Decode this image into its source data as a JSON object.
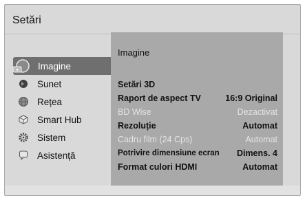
{
  "window": {
    "title": "Setări"
  },
  "menu": {
    "items": [
      {
        "label": "Imagine",
        "icon": "picture-icon",
        "selected": true
      },
      {
        "label": "Sunet",
        "icon": "speaker-icon",
        "selected": false
      },
      {
        "label": "Rețea",
        "icon": "network-globe-icon",
        "selected": false
      },
      {
        "label": "Smart Hub",
        "icon": "smart-hub-cube-icon",
        "selected": false
      },
      {
        "label": "Sistem",
        "icon": "gear-icon",
        "selected": false
      },
      {
        "label": "Asistență",
        "icon": "support-icon",
        "selected": false
      }
    ]
  },
  "panel": {
    "title": "Imagine",
    "rows": [
      {
        "label": "Setări 3D",
        "value": "",
        "enabled": true
      },
      {
        "label": "Raport de aspect TV",
        "value": "16:9 Original",
        "enabled": true
      },
      {
        "label": "BD Wise",
        "value": "Dezactivat",
        "enabled": false
      },
      {
        "label": "Rezoluție",
        "value": "Automat",
        "enabled": true
      },
      {
        "label": "Cadru film (24 Cps)",
        "value": "Automat",
        "enabled": false
      },
      {
        "label": "Potrivire dimensiune ecran",
        "value": "Dimens. 4",
        "enabled": true
      },
      {
        "label": "Format culori HDMI",
        "value": "Automat",
        "enabled": true
      }
    ]
  },
  "colors": {
    "screen_bg": "#d9d9d9",
    "panel_bg": "#a9a9a9",
    "selected_bg": "#6f6f6f",
    "disabled_text": "#e4e4e4"
  }
}
